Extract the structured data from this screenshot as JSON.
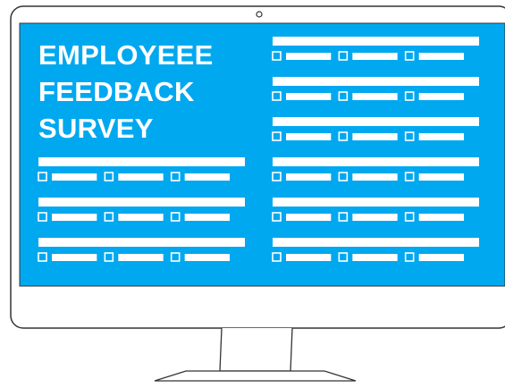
{
  "survey": {
    "title_lines": [
      "EMPLOYEEE",
      "FEEDBACK",
      "SURVEY"
    ],
    "accent_color": "#00a8f0",
    "outline_color": "#333333"
  },
  "icons": {
    "camera": "webcam-icon",
    "checkbox": "checkbox-icon"
  }
}
